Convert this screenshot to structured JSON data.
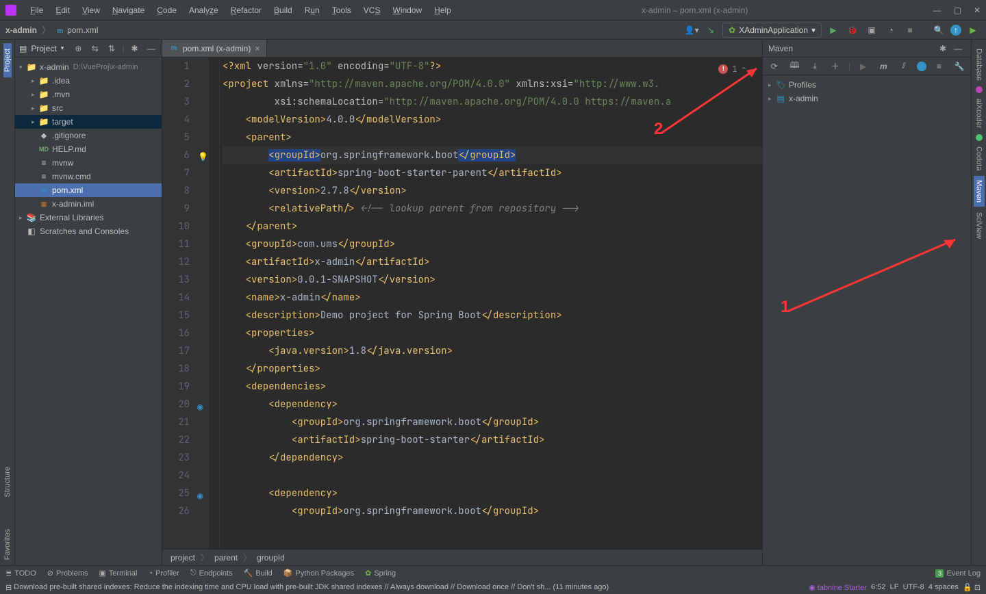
{
  "title_bar": "x-admin – pom.xml (x-admin)",
  "menu": [
    "File",
    "Edit",
    "View",
    "Navigate",
    "Code",
    "Analyze",
    "Refactor",
    "Build",
    "Run",
    "Tools",
    "VCS",
    "Window",
    "Help"
  ],
  "breadcrumb_top": {
    "project": "x-admin",
    "file": "pom.xml",
    "file_icon": "m"
  },
  "run_config": "XAdminApplication",
  "project_panel": {
    "title": "Project",
    "tree": [
      {
        "depth": 0,
        "arrow": "v",
        "icon": "folder",
        "label": "x-admin",
        "path": "D:\\VueProj\\x-admin"
      },
      {
        "depth": 1,
        "arrow": ">",
        "icon": "folder",
        "label": ".idea"
      },
      {
        "depth": 1,
        "arrow": ">",
        "icon": "folder",
        "label": ".mvn"
      },
      {
        "depth": 1,
        "arrow": ">",
        "icon": "folder",
        "label": "src"
      },
      {
        "depth": 1,
        "arrow": ">",
        "icon": "folder-orange",
        "label": "target",
        "hlt": true
      },
      {
        "depth": 1,
        "arrow": "",
        "icon": "git",
        "label": ".gitignore"
      },
      {
        "depth": 1,
        "arrow": "",
        "icon": "md",
        "label": "HELP.md"
      },
      {
        "depth": 1,
        "arrow": "",
        "icon": "file",
        "label": "mvnw"
      },
      {
        "depth": 1,
        "arrow": "",
        "icon": "file",
        "label": "mvnw.cmd"
      },
      {
        "depth": 1,
        "arrow": "",
        "icon": "m",
        "label": "pom.xml",
        "sel": true
      },
      {
        "depth": 1,
        "arrow": "",
        "icon": "iml",
        "label": "x-admin.iml"
      },
      {
        "depth": 0,
        "arrow": ">",
        "icon": "lib",
        "label": "External Libraries"
      },
      {
        "depth": 0,
        "arrow": "",
        "icon": "scratch",
        "label": "Scratches and Consoles"
      }
    ]
  },
  "editor": {
    "tab": {
      "label": "pom.xml (x-admin)"
    },
    "err_count": "1",
    "lines": [
      1,
      2,
      3,
      4,
      5,
      6,
      7,
      8,
      9,
      10,
      11,
      12,
      13,
      14,
      15,
      16,
      17,
      18,
      19,
      20,
      21,
      22,
      23,
      24,
      25,
      26
    ],
    "breadcrumbs": [
      "project",
      "parent",
      "groupId"
    ]
  },
  "maven": {
    "title": "Maven",
    "items": [
      {
        "arrow": ">",
        "icon": "profiles",
        "label": "Profiles"
      },
      {
        "arrow": ">",
        "icon": "module",
        "label": "x-admin"
      }
    ]
  },
  "left_tabs": [
    "Project",
    "Structure",
    "Favorites"
  ],
  "right_tabs": [
    "Database",
    "aiXcoder",
    "Codota",
    "Maven",
    "SciView"
  ],
  "bottom_tools": [
    "TODO",
    "Problems",
    "Terminal",
    "Profiler",
    "Endpoints",
    "Build",
    "Python Packages",
    "Spring"
  ],
  "status": {
    "msg": "Download pre-built shared indexes: Reduce the indexing time and CPU load with pre-built JDK shared indexes // Always download // Download once // Don't sh... (11 minutes ago)",
    "tabnine": "tabnine Starter",
    "pos": "6:52",
    "le": "LF",
    "enc": "UTF-8",
    "indent": "4 spaces",
    "event_log": "Event Log"
  },
  "annotations": {
    "a1": "1",
    "a2": "2"
  }
}
